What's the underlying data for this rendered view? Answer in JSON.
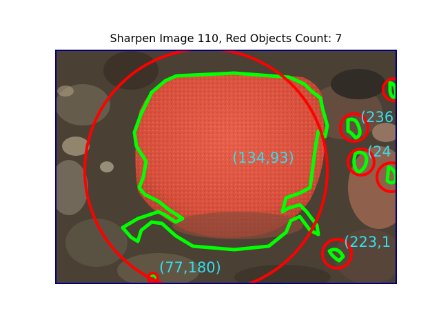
{
  "figure": {
    "title": "Sharpen Image 110, Red Objects Count: 7"
  },
  "colors": {
    "frame": "#000080",
    "contour": "#00ff00",
    "circle": "#ff0000",
    "label": "#33ddee",
    "object_fill": "#e0503f",
    "background": "#4a4034"
  },
  "labels": {
    "main": "(134,93)",
    "top_right": "(236",
    "mid_right": "(24",
    "bottom_right": "(223,1",
    "bottom_left": "(77,180)"
  }
}
